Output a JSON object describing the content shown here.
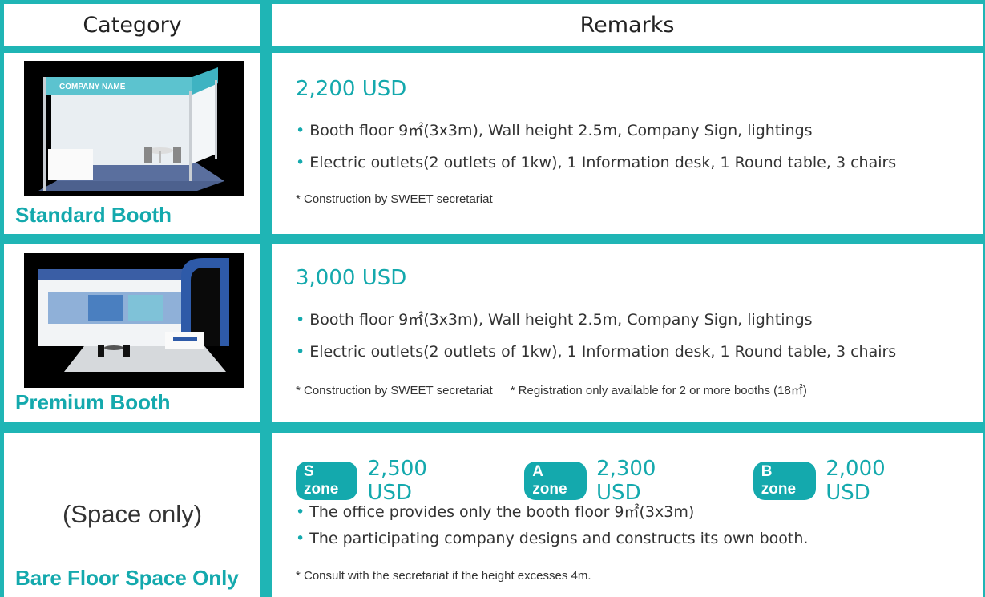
{
  "header": {
    "category": "Category",
    "remarks": "Remarks"
  },
  "rows": [
    {
      "name": "Standard Booth",
      "price": "2,200 USD",
      "bullets": [
        "Booth floor 9㎡(3x3m), Wall height 2.5m, Company Sign,  lightings",
        "Electric outlets(2 outlets of 1kw), 1 Information desk, 1 Round table, 3 chairs"
      ],
      "notes": [
        "* Construction by SWEET secretariat"
      ],
      "image_sign": "COMPANY NAME"
    },
    {
      "name": "Premium Booth",
      "price": "3,000 USD",
      "bullets": [
        "Booth floor 9㎡(3x3m), Wall height  2.5m, Company Sign, lightings",
        "Electric outlets(2 outlets of 1kw), 1 Information desk, 1 Round table, 3 chairs"
      ],
      "notes": [
        "* Construction by SWEET secretariat",
        "* Registration only available for 2 or more booths (18㎡)"
      ]
    },
    {
      "name": "Bare Floor Space Only",
      "label": "(Space only)",
      "zones": [
        {
          "badge": "S zone",
          "price": "2,500 USD"
        },
        {
          "badge": "A zone",
          "price": "2,300 USD"
        },
        {
          "badge": "B zone",
          "price": "2,000 USD"
        }
      ],
      "bullets": [
        "The office provides only the booth floor 9㎡(3x3m)",
        "The participating company designs and constructs its own booth."
      ],
      "notes": [
        "* Consult with the secretariat if the height excesses 4m."
      ]
    }
  ],
  "colors": {
    "accent": "#14a9ad",
    "border": "#1fb5b5"
  }
}
